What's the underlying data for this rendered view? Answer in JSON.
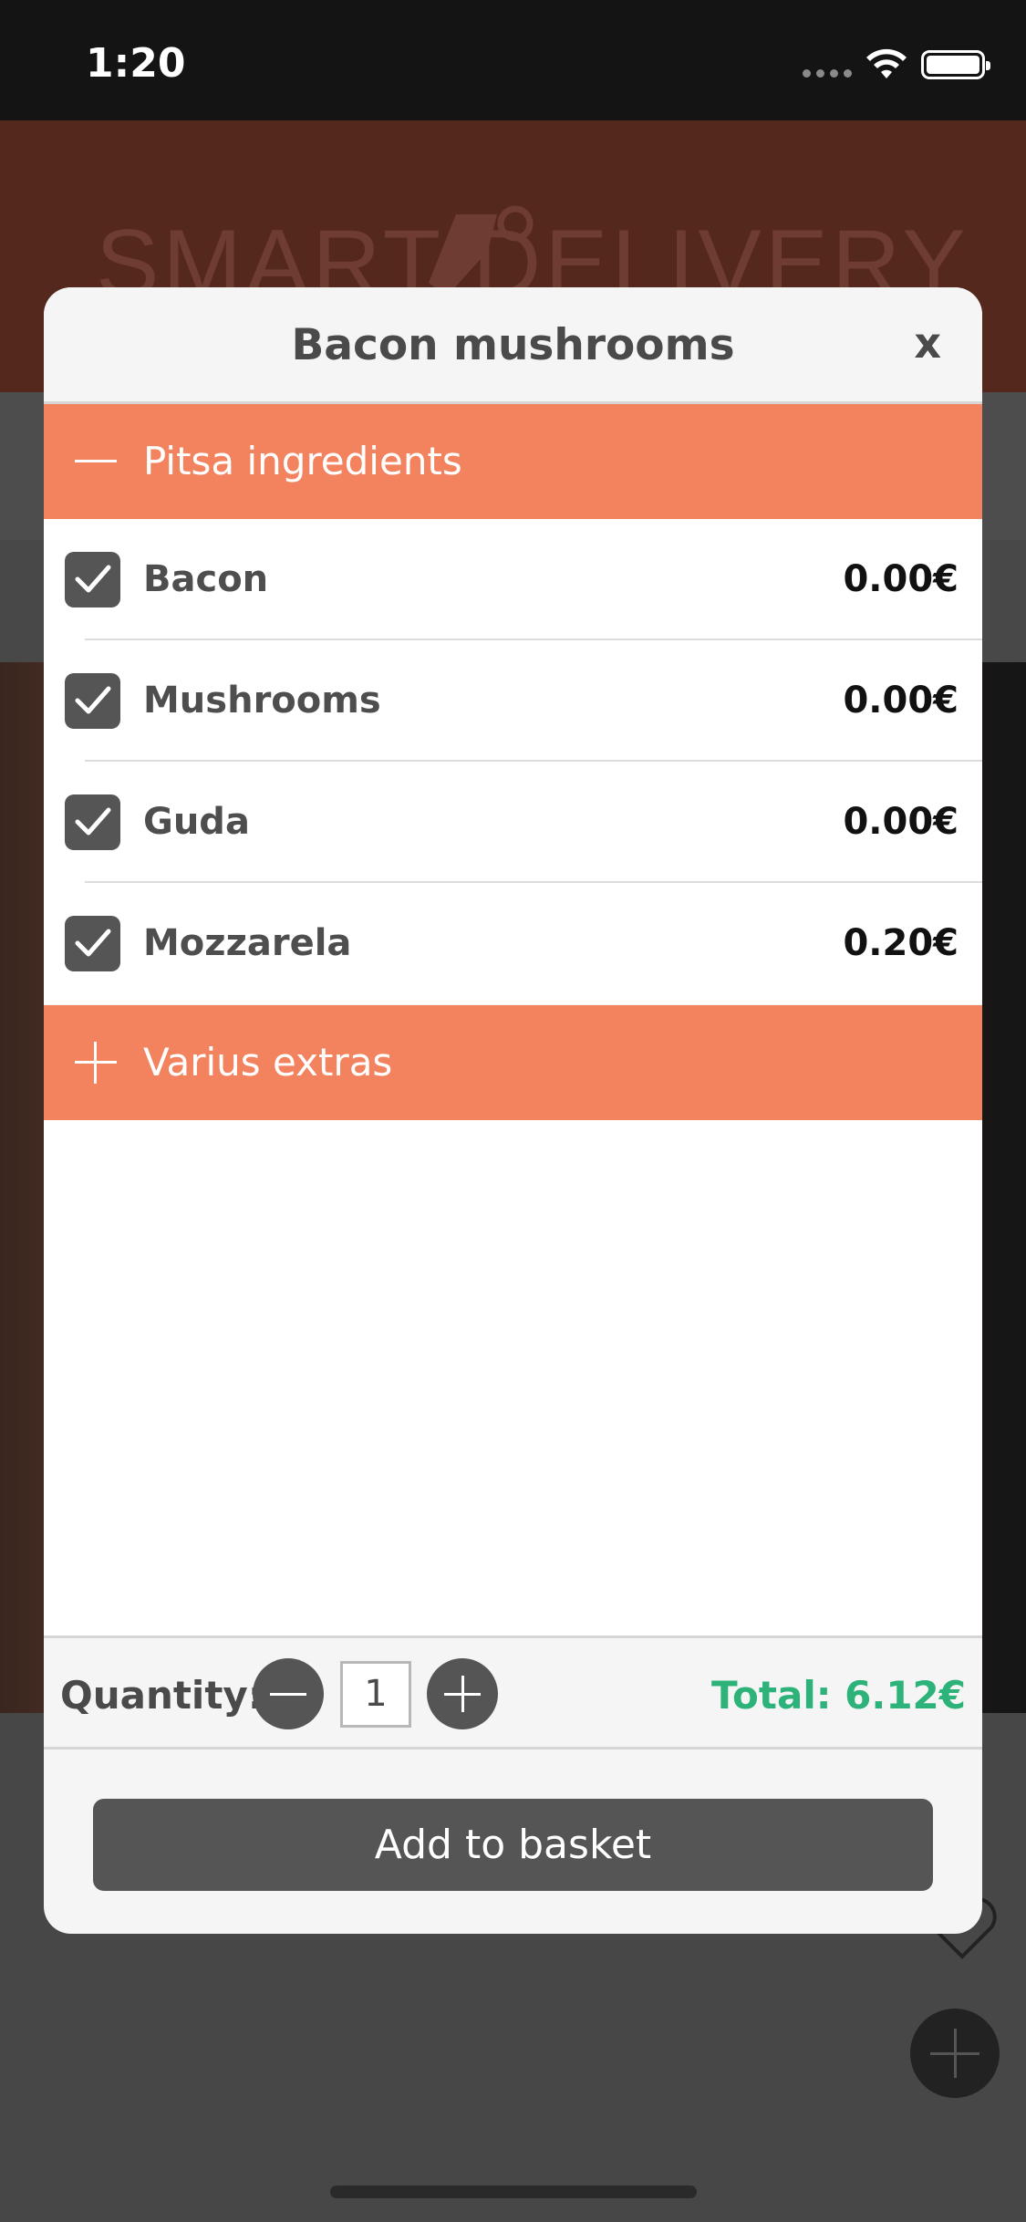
{
  "status_bar": {
    "time": "1:20",
    "icons": [
      "signal-dots-icon",
      "wifi-icon",
      "battery-icon"
    ]
  },
  "background": {
    "logo_text": "SMART DELIVERY"
  },
  "modal": {
    "title": "Bacon mushrooms",
    "close_label": "x",
    "sections": [
      {
        "label": "Pitsa ingredients",
        "expanded": true,
        "icon": "minus-icon"
      },
      {
        "label": "Varius extras",
        "expanded": false,
        "icon": "plus-icon"
      }
    ],
    "items": [
      {
        "name": "Bacon",
        "price": "0.00€",
        "checked": true
      },
      {
        "name": "Mushrooms",
        "price": "0.00€",
        "checked": true
      },
      {
        "name": "Guda",
        "price": "0.00€",
        "checked": true
      },
      {
        "name": "Mozzarela",
        "price": "0.20€",
        "checked": true
      }
    ],
    "quantity": {
      "label": "Quantity:",
      "value": "1"
    },
    "total": "Total: 6.12€",
    "add_button": "Add to basket"
  },
  "colors": {
    "accent_orange": "#f2835e",
    "button_dark": "#555555",
    "total_green": "#2db37a"
  }
}
